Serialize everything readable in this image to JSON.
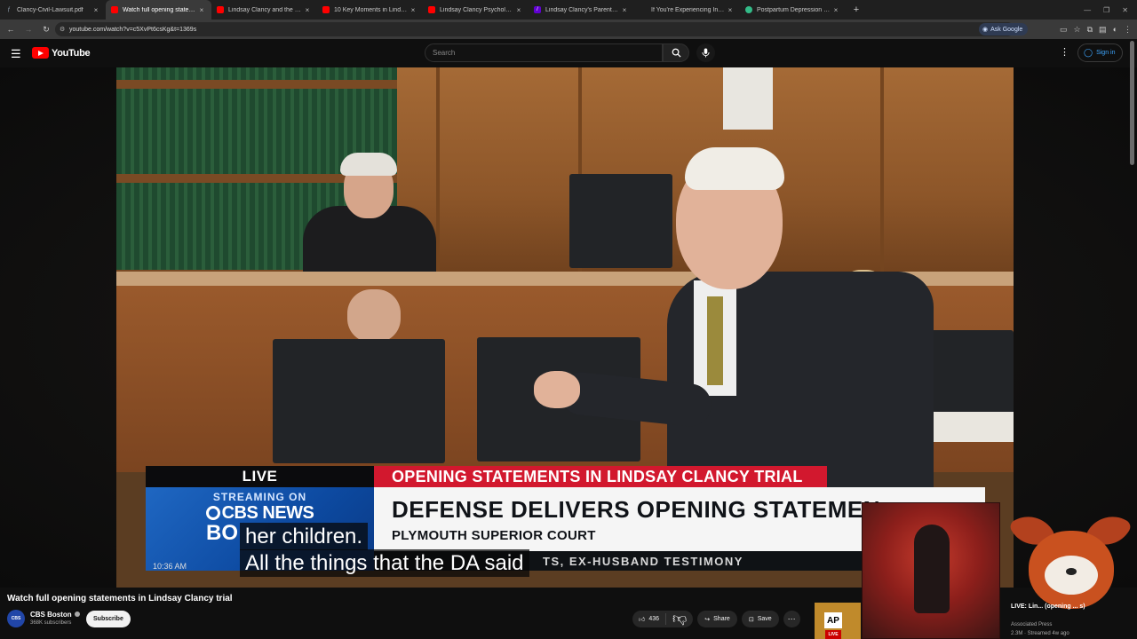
{
  "browser": {
    "tabs": [
      {
        "title": "Clancy-Civil-Lawsuit.pdf",
        "icon": "pdf-icon",
        "active": false
      },
      {
        "title": "Watch full opening statements",
        "icon": "youtube-icon",
        "active": true
      },
      {
        "title": "Lindsay Clancy and the Evidenc",
        "icon": "youtube-icon",
        "active": false
      },
      {
        "title": "10 Key Moments in Lindsay Cl",
        "icon": "youtube-icon",
        "active": false
      },
      {
        "title": "Lindsay Clancy Psychologist Di",
        "icon": "youtube-icon",
        "active": false
      },
      {
        "title": "Lindsay Clancy's Parents' $1 M",
        "icon": "yahoo-icon",
        "active": false
      },
      {
        "title": "If You're Experiencing Intrusive",
        "icon": "page-icon",
        "active": false
      },
      {
        "title": "Postpartum Depression (PPD)",
        "icon": "globe-icon",
        "active": false
      }
    ],
    "url": "youtube.com/watch?v=c5XvPt6csKg&t=1369s",
    "ask_google": "Ask Google"
  },
  "youtube": {
    "logo_text": "YouTube",
    "search_placeholder": "Search",
    "sign_in": "Sign in"
  },
  "video": {
    "chyron": {
      "live": "LIVE",
      "red_banner": "OPENING STATEMENTS IN LINDSAY CLANCY TRIAL",
      "streaming_on": "STREAMING ON",
      "network": "CBS NEWS",
      "city_partial": "BO",
      "time_partial": "10:36 AM",
      "headline": "DEFENSE DELIVERS OPENING STATEMEN",
      "subhead": "PLYMOUTH SUPERIOR COURT",
      "ticker": "TS, EX-HUSBAND TESTIMONY"
    },
    "captions": [
      "her children.",
      "All the things that the DA said"
    ]
  },
  "details": {
    "title": "Watch full opening statements in Lindsay Clancy trial",
    "channel": "CBS Boston",
    "channel_avatar": "CBS",
    "subscribers": "368K subscribers",
    "subscribe": "Subscribe",
    "likes": "436",
    "share": "Share",
    "save": "Save"
  },
  "recommendation": {
    "logo": "AP",
    "badge": "LIVE",
    "title": "LIVE: Lin... (opening ... s)",
    "channel": "Associated Press",
    "meta": "2.3M · Streamed 4w ago"
  },
  "colors": {
    "youtube_red": "#ff0000",
    "chyron_red": "#d2182e",
    "cbs_blue": "#1f67c2",
    "link_blue": "#3ea6ff"
  }
}
